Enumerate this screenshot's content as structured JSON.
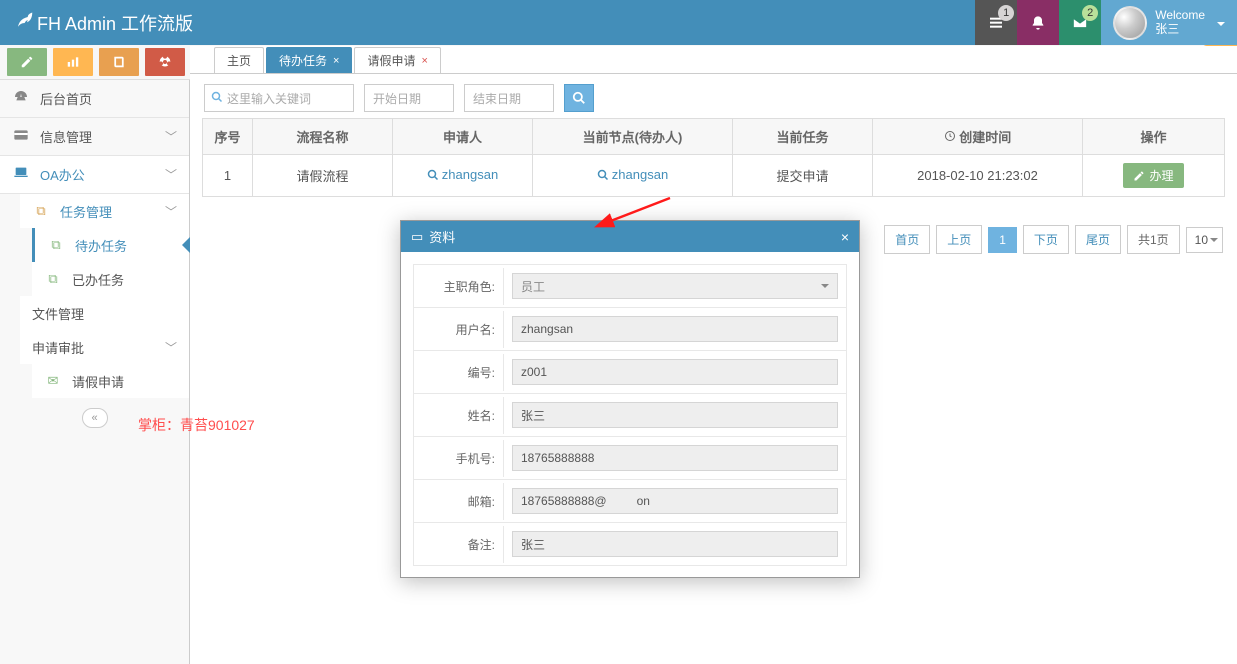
{
  "brand_title": "FH Admin 工作流版",
  "navbar": {
    "badge1": "1",
    "badge2": "2",
    "welcome": "Welcome",
    "username": "张三"
  },
  "sidebar": {
    "items": [
      {
        "label": "后台首页"
      },
      {
        "label": "信息管理"
      },
      {
        "label": "OA办公"
      },
      {
        "label": "任务管理"
      },
      {
        "label": "待办任务"
      },
      {
        "label": "已办任务"
      },
      {
        "label": "文件管理"
      },
      {
        "label": "申请审批"
      },
      {
        "label": "请假申请"
      }
    ]
  },
  "tabs": [
    {
      "label": "主页"
    },
    {
      "label": "待办任务"
    },
    {
      "label": "请假申请"
    }
  ],
  "filter": {
    "search_placeholder": "这里输入关键词",
    "start_date_ph": "开始日期",
    "end_date_ph": "结束日期"
  },
  "table": {
    "headers": {
      "seq": "序号",
      "flow": "流程名称",
      "applicant": "申请人",
      "node": "当前节点(待办人)",
      "task": "当前任务",
      "created_icon": "",
      "created": "创建时间",
      "op": "操作"
    },
    "row": {
      "seq": "1",
      "flow": "请假流程",
      "applicant": "zhangsan",
      "node": "zhangsan",
      "task": "提交申请",
      "created": "2018-02-10 21:23:02",
      "handle": "办理"
    }
  },
  "pagination": {
    "first": "首页",
    "prev": "上页",
    "current": "1",
    "next": "下页",
    "last": "尾页",
    "total": "共1页",
    "size": "10"
  },
  "modal": {
    "title": "资料",
    "labels": {
      "role": "主职角色:",
      "username": "用户名:",
      "code": "编号:",
      "name": "姓名:",
      "phone": "手机号:",
      "email": "邮箱:",
      "remark": "备注:"
    },
    "values": {
      "role": "员工",
      "username": "zhangsan",
      "code": "z001",
      "name": "张三",
      "phone": "18765888888",
      "email": "18765888888@         on",
      "remark": "张三"
    }
  },
  "watermark": "掌柜：青苔901027"
}
